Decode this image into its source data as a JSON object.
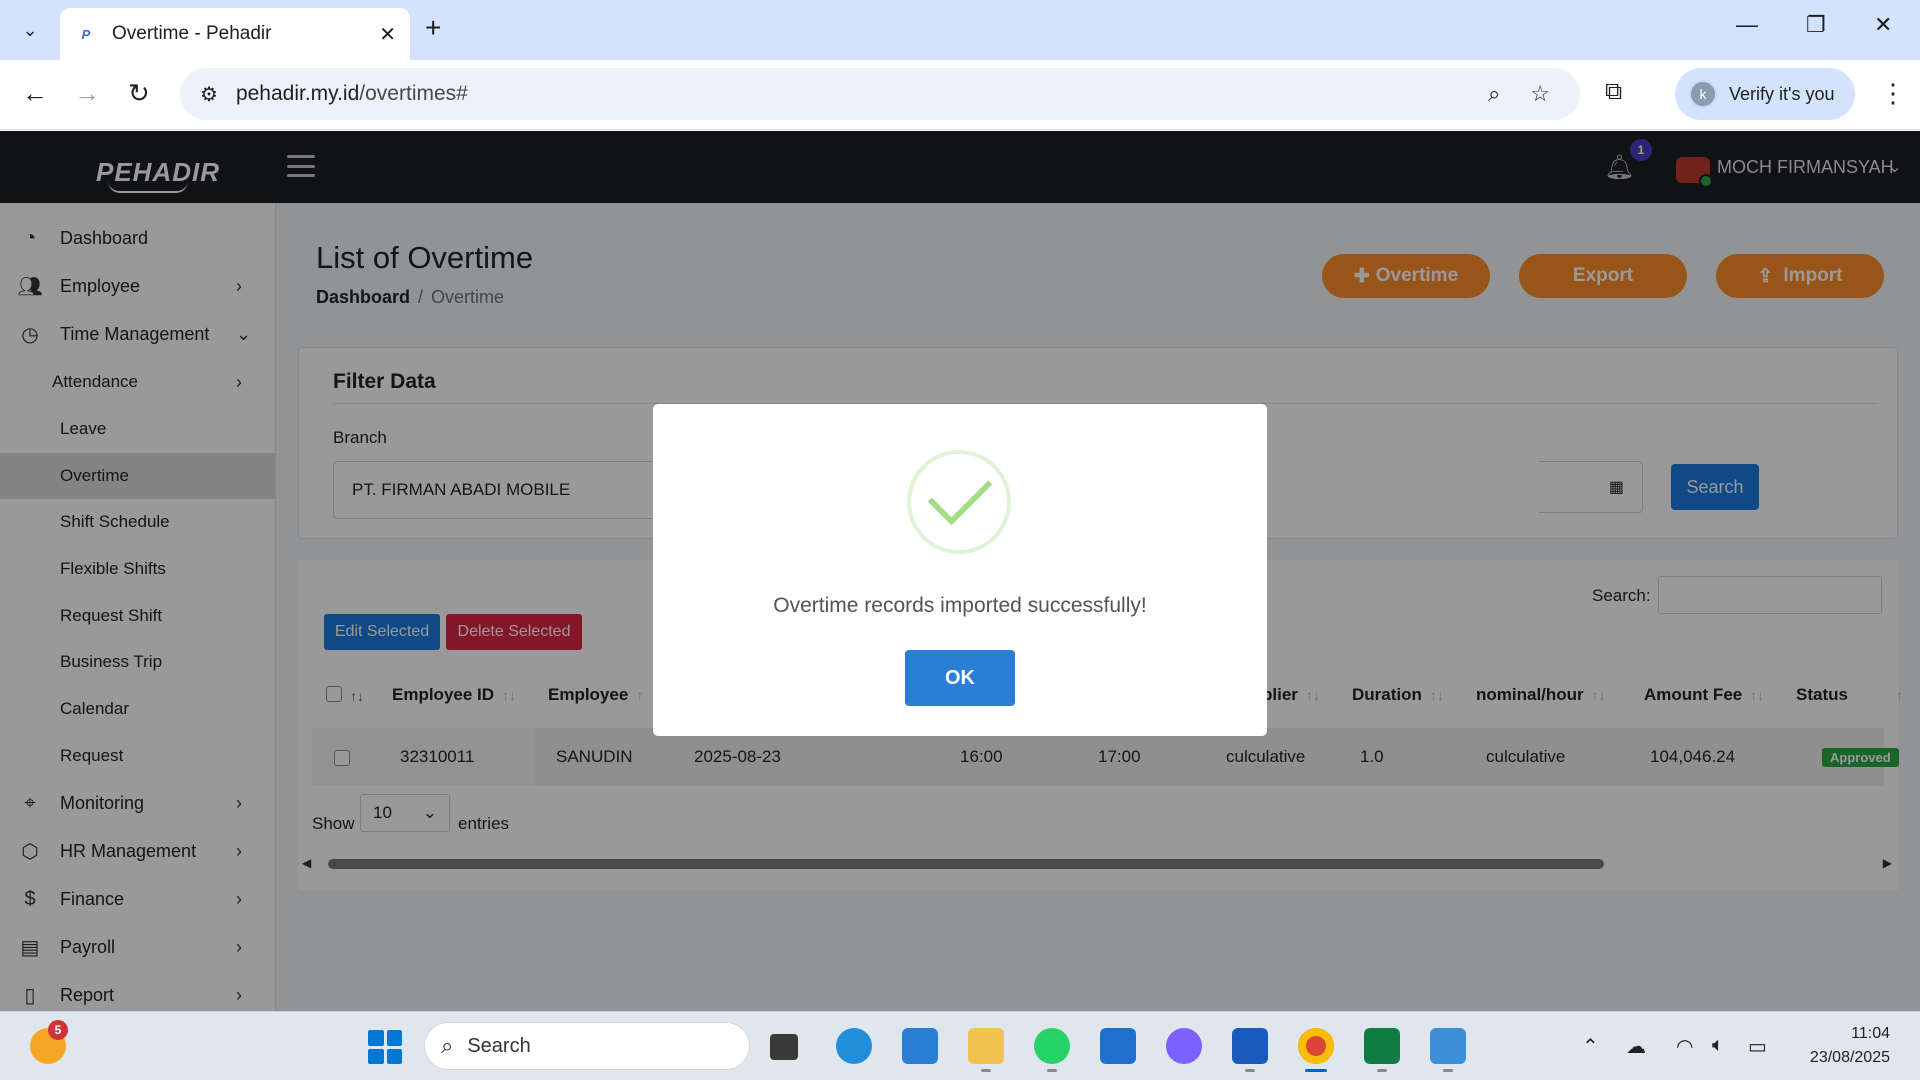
{
  "browser": {
    "tab_title": "Overtime - Pehadir",
    "url_host": "pehadir.my.id",
    "url_path": "/overtimes#",
    "profile_label": "Verify it's you",
    "profile_initial": "k"
  },
  "header": {
    "logo_text": "PEHADIR",
    "notification_count": "1",
    "user_name": "MOCH FIRMANSYAH"
  },
  "sidebar": {
    "items": [
      {
        "label": "Dashboard",
        "icon": "gauge-icon"
      },
      {
        "label": "Employee",
        "icon": "users-icon"
      },
      {
        "label": "Time Management",
        "icon": "clock-icon"
      },
      {
        "label": "Attendance"
      },
      {
        "label": "Leave"
      },
      {
        "label": "Overtime"
      },
      {
        "label": "Shift Schedule"
      },
      {
        "label": "Flexible Shifts"
      },
      {
        "label": "Request Shift"
      },
      {
        "label": "Business Trip"
      },
      {
        "label": "Calendar"
      },
      {
        "label": "Request"
      },
      {
        "label": "Monitoring",
        "icon": "map-pin-icon"
      },
      {
        "label": "HR Management",
        "icon": "cube-icon"
      },
      {
        "label": "Finance",
        "icon": "dollar-icon"
      },
      {
        "label": "Payroll",
        "icon": "book-icon"
      },
      {
        "label": "Report",
        "icon": "file-icon"
      }
    ]
  },
  "main": {
    "title": "List of Overtime",
    "breadcrumb": {
      "home": "Dashboard",
      "separator": "/",
      "current": "Overtime"
    },
    "buttons": {
      "add": "Overtime",
      "export": "Export",
      "import": "Import"
    },
    "filter": {
      "title": "Filter Data",
      "branch_label": "Branch",
      "branch_value": "PT. FIRMAN ABADI MOBILE",
      "search_button": "Search"
    },
    "table": {
      "search_label": "Search:",
      "edit_selected": "Edit Selected",
      "delete_selected": "Delete Selected",
      "columns": [
        "Employee ID",
        "Employee",
        "plier",
        "Duration",
        "nominal/hour",
        "Amount Fee",
        "Status"
      ],
      "rows": [
        {
          "employee_id": "32310011",
          "employee": "SANUDIN",
          "date": "2025-08-23",
          "start": "16:00",
          "end": "17:00",
          "multiplier": "culculative",
          "duration": "1.0",
          "nominal_hour": "culculative",
          "amount_fee": "104,046.24",
          "status": "Approved"
        }
      ],
      "show_label": "Show",
      "page_size": "10",
      "entries_label": "entries"
    }
  },
  "modal": {
    "message": "Overtime records imported successfully!",
    "ok_label": "OK"
  },
  "taskbar": {
    "widget_badge": "5",
    "search_placeholder": "Search",
    "time": "11:04",
    "date": "23/08/2025"
  },
  "colors": {
    "orange": "#fd8e2a",
    "primary": "#1a7ae0",
    "danger": "#dc2545",
    "success": "#28a745",
    "header_dark": "#1b1f23"
  }
}
